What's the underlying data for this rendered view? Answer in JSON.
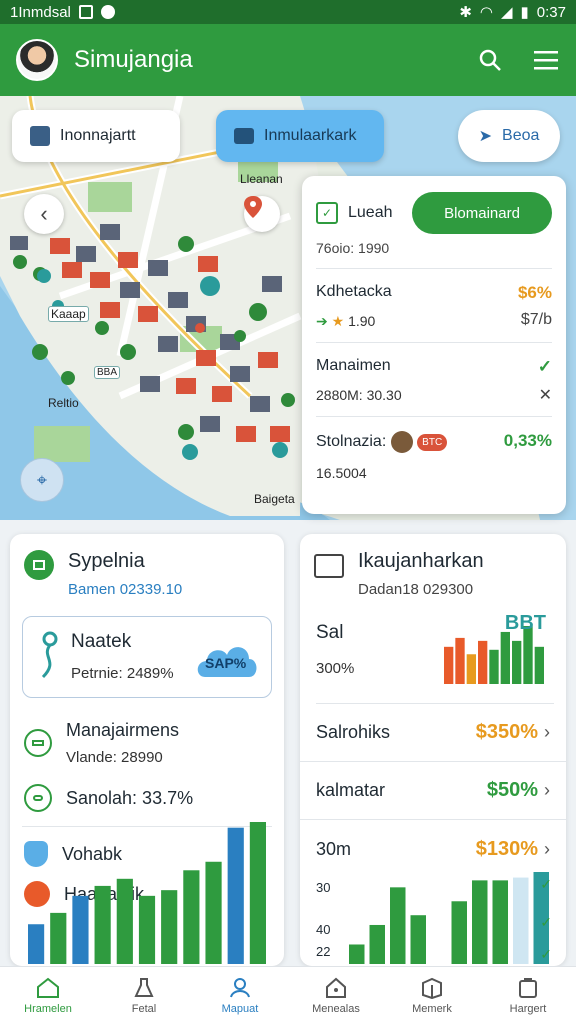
{
  "status_bar": {
    "left_text": "1Inmdsal",
    "time": "0:37"
  },
  "app_bar": {
    "title": "Simujangia"
  },
  "map": {
    "chip_left": "Inonnajartt",
    "chip_middle": "Inmulaarkark",
    "chip_right": "Beoa",
    "labels": {
      "top": "Lleanan",
      "left_tag": "Kaaap",
      "left": "Reltio",
      "bottom": "Baigeta",
      "tag_small": "BBA"
    }
  },
  "overlay": {
    "title": "Lueah",
    "cta": "Blomainard",
    "subtitle": "76oio: 1990",
    "rows": [
      {
        "title": "Kdhetacka",
        "sub": "1.90",
        "value": "$6%",
        "value2": "$7/b"
      },
      {
        "title": "Manaimen",
        "sub": "2880M: 30.30",
        "value": "✓",
        "value2": "✕"
      },
      {
        "title": "Stolnazia:",
        "sub": "16.5004",
        "value": "0,33%",
        "badge": "BTC"
      }
    ]
  },
  "card_left": {
    "title": "Sypelnia",
    "subtitle": "Bamen 02339.10",
    "box_title": "Naatek",
    "box_sub": "Petrnie: 2489%",
    "box_badge": "SAP%",
    "rows": [
      {
        "title": "Manajairmens",
        "sub": "Vlande: 28990"
      },
      {
        "title": "Sanolah: 33.7%"
      },
      {
        "title": "Vohabk"
      },
      {
        "title": "Haanaiaik"
      }
    ]
  },
  "card_right": {
    "title": "Ikaujanharkan",
    "subtitle": "Dadan18 029300",
    "chart_title": "Sal",
    "chart_sub": "300%",
    "chart_badge": "BBT",
    "rows": [
      {
        "label": "Salrohiks",
        "value": "$350%",
        "color": "#e79a1f"
      },
      {
        "label": "kalmatar",
        "value": "$50%",
        "color": "#2f9b3f"
      },
      {
        "label": "30m",
        "value": "$130%",
        "color": "#e79a1f"
      }
    ],
    "axis_labels": [
      "30",
      "40",
      "22"
    ]
  },
  "chart_data": [
    {
      "type": "bar",
      "values": [
        28,
        36,
        48,
        55,
        60,
        48,
        52,
        66,
        72,
        96,
        100
      ],
      "colors": [
        "#2a7fc1",
        "#2f9b3f",
        "#2a7fc1",
        "#2f9b3f",
        "#2f9b3f",
        "#2f9b3f",
        "#2f9b3f",
        "#2f9b3f",
        "#2f9b3f",
        "#2a7fc1",
        "#2f9b3f"
      ]
    },
    {
      "type": "bar",
      "values": [
        14,
        28,
        55,
        35,
        20,
        45,
        60,
        60,
        62,
        66
      ],
      "colors": [
        "#2f9b3f",
        "#2f9b3f",
        "#2f9b3f",
        "#2f9b3f",
        "#ffffff",
        "#2f9b3f",
        "#2f9b3f",
        "#2f9b3f",
        "#cfe6f2",
        "#2a9b9b"
      ]
    },
    {
      "type": "bar",
      "values": [
        50,
        62,
        40,
        58,
        46,
        70,
        58,
        78,
        50
      ],
      "colors": [
        "#e85a2a",
        "#e85a2a",
        "#e79a1f",
        "#e85a2a",
        "#2f9b3f",
        "#2f9b3f",
        "#2f9b3f",
        "#2f9b3f",
        "#2f9b3f"
      ]
    }
  ],
  "bottom_nav": [
    {
      "label": "Hramelen",
      "state": "green"
    },
    {
      "label": "Fetal",
      "state": ""
    },
    {
      "label": "Mapuat",
      "state": "blue"
    },
    {
      "label": "Menealas",
      "state": ""
    },
    {
      "label": "Memerk",
      "state": ""
    },
    {
      "label": "Hargert",
      "state": ""
    }
  ]
}
